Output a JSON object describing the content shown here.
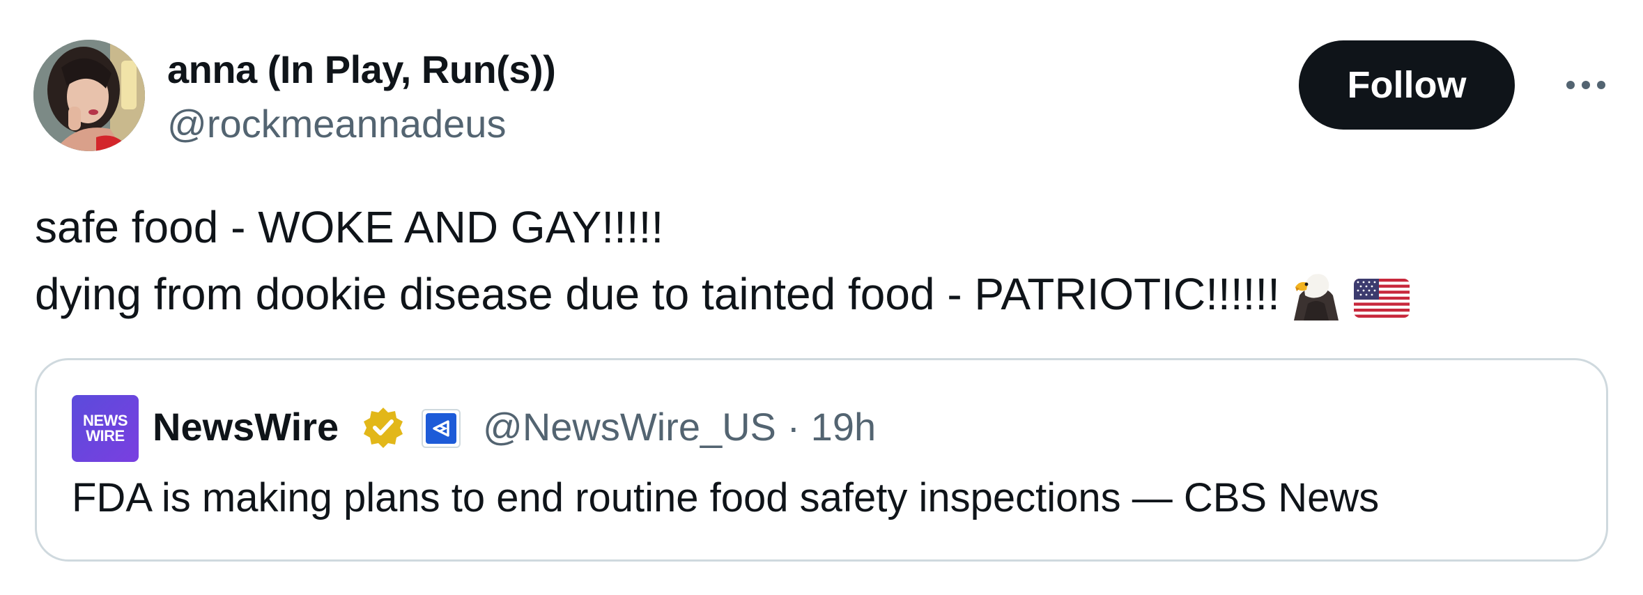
{
  "author": {
    "display_name": "anna (In Play, Run(s))",
    "handle": "@rockmeannadeus"
  },
  "actions": {
    "follow_label": "Follow",
    "more_icon": "more-horizontal-icon"
  },
  "tweet": {
    "line1": "safe food - WOKE AND GAY!!!!!",
    "line2": "dying from dookie disease due to tainted food - PATRIOTIC!!!!!!",
    "emojis": [
      "eagle-emoji",
      "us-flag-emoji"
    ]
  },
  "quoted": {
    "logo_line1": "NEWS",
    "logo_line2": "WIRE",
    "name": "NewsWire",
    "handle_time": "@NewsWire_US · 19h",
    "text": "FDA is making plans to end routine food safety inspections — CBS News",
    "verified_color": "#e2b719"
  },
  "colors": {
    "text": "#0f1419",
    "secondary": "#536471",
    "border": "#cfd9de",
    "button": "#0f1419"
  }
}
